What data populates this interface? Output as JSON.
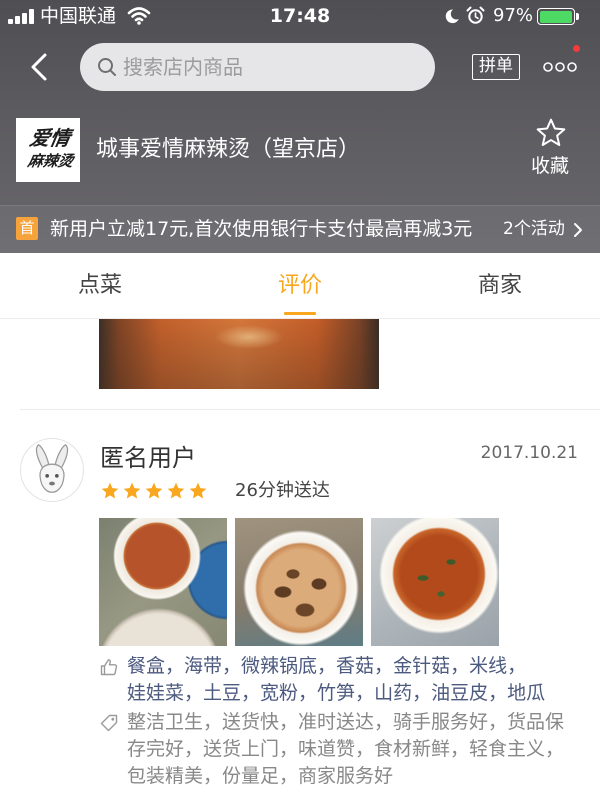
{
  "status_bar": {
    "carrier": "中国联通",
    "time": "17:48",
    "battery_percent": "97%",
    "battery_level": 0.97
  },
  "header": {
    "search_placeholder": "搜索店内商品",
    "group_order_label": "拼单",
    "more_has_badge": true
  },
  "store": {
    "name": "城事爱情麻辣烫（望京店）",
    "logo_text": [
      "爱情",
      "麻辣烫"
    ],
    "favorite_label": "收藏"
  },
  "promo": {
    "badge": "首",
    "text": "新用户立减17元,首次使用银行卡支付最高再减3元",
    "activities_label": "2个活动"
  },
  "tabs": [
    {
      "label": "点菜",
      "active": false
    },
    {
      "label": "评价",
      "active": true
    },
    {
      "label": "商家",
      "active": false
    }
  ],
  "review": {
    "user_name": "匿名用户",
    "date": "2017.10.21",
    "rating": 5,
    "rating_max": 5,
    "delivery_time": "26分钟送达",
    "separator": "，",
    "recommended_dishes": [
      "餐盒",
      "海带",
      "微辣锅底",
      "香菇",
      "金针菇",
      "米线",
      "娃娃菜",
      "土豆",
      "宽粉",
      "竹笋",
      "山药",
      "油豆皮",
      "地瓜"
    ],
    "tags": [
      "整洁卫生",
      "送货快",
      "准时送达",
      "骑手服务好",
      "货品保存完好",
      "送货上门",
      "味道赞",
      "食材新鲜",
      "轻食主义",
      "包装精美",
      "份量足",
      "商家服务好"
    ]
  },
  "icons": {
    "signal": "signal-icon",
    "wifi": "wifi-icon",
    "do_not_disturb": "moon-icon",
    "alarm": "alarm-icon",
    "battery": "battery-icon",
    "back": "chevron-left-icon",
    "search": "search-icon",
    "more": "more-icon",
    "favorite": "star-outline-icon",
    "activities": "chevron-right-icon",
    "rating": "star-icon",
    "dishes": "thumbs-up-icon",
    "tags": "tag-icon"
  },
  "colors": {
    "accent": "#f9a71e",
    "dish_text": "#4d5a80",
    "tag_text": "#888888",
    "badge": "#f5a33a",
    "notification_dot": "#f23b3b",
    "battery": "#4cd964",
    "star_empty": "#e0e0e0"
  }
}
